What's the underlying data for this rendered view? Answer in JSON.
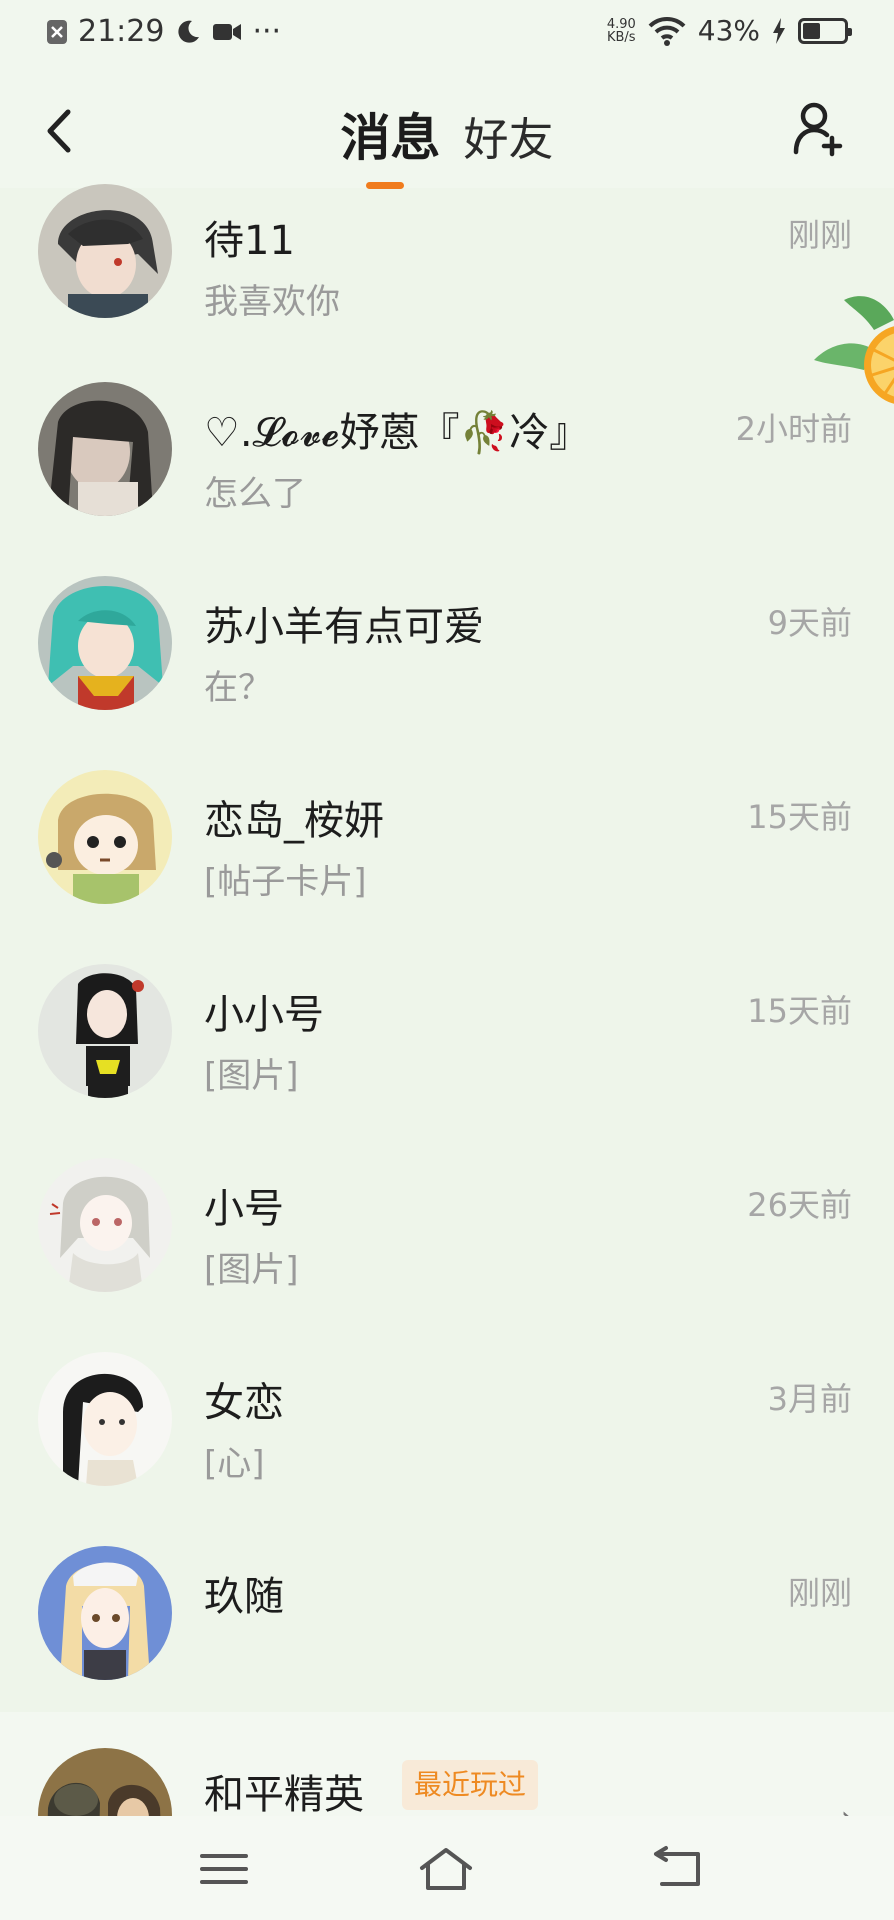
{
  "status_bar": {
    "time": "21:29",
    "dots": "···",
    "net_speed_value": "4.90",
    "net_speed_unit": "KB/s",
    "battery": "43%",
    "battery_level": 0.43
  },
  "header": {
    "tab_active": "消息",
    "tab_other": "好友"
  },
  "conversations": [
    {
      "name": "待11",
      "message": "我喜欢你",
      "time": "刚刚",
      "avatar": "anime-boy-dark-hair"
    },
    {
      "name": "♡.𝓛𝓸𝓿𝓮妤蒽『🥀冷』",
      "message": "怎么了",
      "time": "2小时前",
      "avatar": "girl-photo"
    },
    {
      "name": "苏小羊有点可爱",
      "message": "在？",
      "time": "9天前",
      "avatar": "anime-teal-hair"
    },
    {
      "name": "恋岛_桉妍",
      "message": "[帖子卡片]",
      "time": "15天前",
      "avatar": "anime-brown-hair"
    },
    {
      "name": "小小号",
      "message": "[图片]",
      "time": "15天前",
      "avatar": "anime-black-hair-girl"
    },
    {
      "name": "小号",
      "message": "[图片]",
      "time": "26天前",
      "avatar": "anime-sketch-girl"
    },
    {
      "name": "女恋",
      "message": "[心]",
      "time": "3月前",
      "avatar": "anime-black-hair-sketch"
    },
    {
      "name": "玖随",
      "message": "",
      "time": "刚刚",
      "avatar": "anime-blonde-girl"
    }
  ],
  "game": {
    "name": "和平精英",
    "badge": "最近玩过"
  },
  "colors": {
    "accent": "#f07b1d",
    "background": "#eef5ea",
    "badge_text": "#ee8a22",
    "badge_bg": "#f8ead8"
  }
}
